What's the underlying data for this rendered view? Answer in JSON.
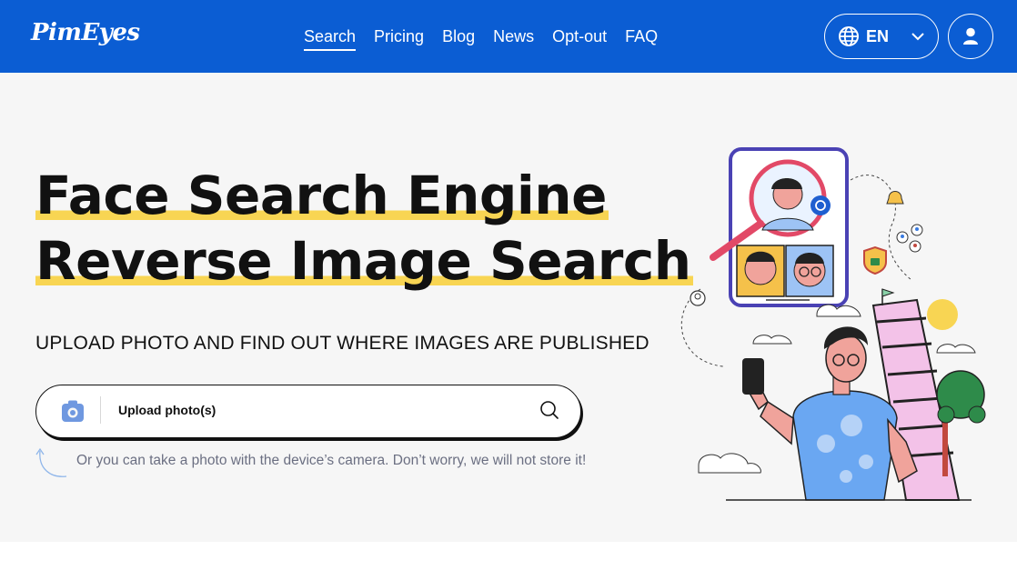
{
  "header": {
    "logo": "PimEyes",
    "nav": [
      "Search",
      "Pricing",
      "Blog",
      "News",
      "Opt-out",
      "FAQ"
    ],
    "active_nav": "Search",
    "language": "EN"
  },
  "hero": {
    "title_line1": "Face Search Engine",
    "title_line2": "Reverse Image Search",
    "subtitle": "UPLOAD PHOTO AND FIND OUT WHERE IMAGES ARE PUBLISHED",
    "upload_label": "Upload photo(s)",
    "camera_hint": "Or you can take a photo with the device’s camera. Don’t worry, we will not store it!"
  },
  "icons": [
    "globe-icon",
    "chevron-down-icon",
    "user-icon",
    "camera-icon",
    "search-icon",
    "curved-arrow-icon"
  ],
  "colors": {
    "brand_blue": "#0b5dd3",
    "highlight_yellow": "#f8d553",
    "camera_icon": "#6f98e0"
  }
}
